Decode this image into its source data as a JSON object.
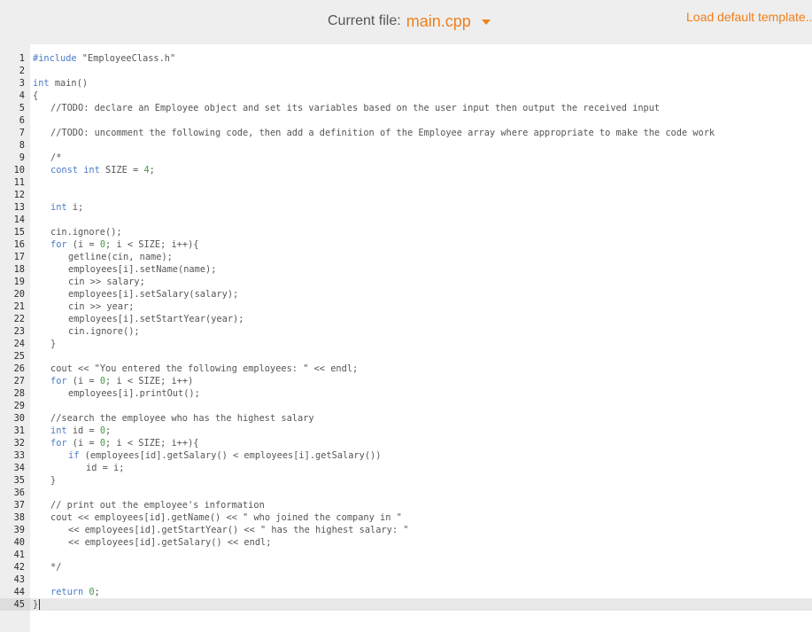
{
  "header": {
    "current_file_label": "Current file:",
    "current_file_name": "main.cpp",
    "load_template_label": "Load default template..."
  },
  "editor": {
    "lines": [
      {
        "n": "1",
        "indent": 0,
        "text": "#include \"EmployeeClass.h\""
      },
      {
        "n": "2",
        "indent": 0,
        "text": ""
      },
      {
        "n": "3",
        "indent": 0,
        "text": "int main()"
      },
      {
        "n": "4",
        "indent": 0,
        "text": "{"
      },
      {
        "n": "5",
        "indent": 20,
        "text": "//TODO: declare an Employee object and set its variables based on the user input then output the received input"
      },
      {
        "n": "6",
        "indent": 0,
        "text": ""
      },
      {
        "n": "7",
        "indent": 20,
        "text": "//TODO: uncomment the following code, then add a definition of the Employee array where appropriate to make the code work"
      },
      {
        "n": "8",
        "indent": 0,
        "text": ""
      },
      {
        "n": "9",
        "indent": 20,
        "text": "/*"
      },
      {
        "n": "10",
        "indent": 20,
        "text": "const int SIZE = 4;"
      },
      {
        "n": "11",
        "indent": 0,
        "text": ""
      },
      {
        "n": "12",
        "indent": 0,
        "text": ""
      },
      {
        "n": "13",
        "indent": 20,
        "text": "int i;"
      },
      {
        "n": "14",
        "indent": 0,
        "text": ""
      },
      {
        "n": "15",
        "indent": 20,
        "text": "cin.ignore();"
      },
      {
        "n": "16",
        "indent": 20,
        "text": "for (i = 0; i < SIZE; i++){"
      },
      {
        "n": "17",
        "indent": 40,
        "text": "getline(cin, name);"
      },
      {
        "n": "18",
        "indent": 40,
        "text": "employees[i].setName(name);"
      },
      {
        "n": "19",
        "indent": 40,
        "text": "cin >> salary;"
      },
      {
        "n": "20",
        "indent": 40,
        "text": "employees[i].setSalary(salary);"
      },
      {
        "n": "21",
        "indent": 40,
        "text": "cin >> year;"
      },
      {
        "n": "22",
        "indent": 40,
        "text": "employees[i].setStartYear(year);"
      },
      {
        "n": "23",
        "indent": 40,
        "text": "cin.ignore();"
      },
      {
        "n": "24",
        "indent": 20,
        "text": "}"
      },
      {
        "n": "25",
        "indent": 0,
        "text": ""
      },
      {
        "n": "26",
        "indent": 20,
        "text": "cout << \"You entered the following employees: \" << endl;"
      },
      {
        "n": "27",
        "indent": 20,
        "text": "for (i = 0; i < SIZE; i++)"
      },
      {
        "n": "28",
        "indent": 40,
        "text": "employees[i].printOut();"
      },
      {
        "n": "29",
        "indent": 0,
        "text": ""
      },
      {
        "n": "30",
        "indent": 20,
        "text": "//search the employee who has the highest salary"
      },
      {
        "n": "31",
        "indent": 20,
        "text": "int id = 0;"
      },
      {
        "n": "32",
        "indent": 20,
        "text": "for (i = 0; i < SIZE; i++){"
      },
      {
        "n": "33",
        "indent": 40,
        "text": "if (employees[id].getSalary() < employees[i].getSalary())"
      },
      {
        "n": "34",
        "indent": 60,
        "text": "id = i;"
      },
      {
        "n": "35",
        "indent": 20,
        "text": "}"
      },
      {
        "n": "36",
        "indent": 0,
        "text": ""
      },
      {
        "n": "37",
        "indent": 20,
        "text": "// print out the employee's information"
      },
      {
        "n": "38",
        "indent": 20,
        "text": "cout << employees[id].getName() << \" who joined the company in \""
      },
      {
        "n": "39",
        "indent": 40,
        "text": "<< employees[id].getStartYear() << \" has the highest salary: \""
      },
      {
        "n": "40",
        "indent": 40,
        "text": "<< employees[id].getSalary() << endl;"
      },
      {
        "n": "41",
        "indent": 0,
        "text": ""
      },
      {
        "n": "42",
        "indent": 20,
        "text": "*/"
      },
      {
        "n": "43",
        "indent": 0,
        "text": ""
      },
      {
        "n": "44",
        "indent": 20,
        "text": "return 0;"
      },
      {
        "n": "45",
        "indent": 0,
        "text": "}"
      }
    ],
    "active_line": "45"
  },
  "colors": {
    "accent": "#f07f1b",
    "keyword": "#4a7cc9",
    "number": "#4a9a4a",
    "text": "#555555",
    "gutter_bg": "#eeeeee"
  }
}
